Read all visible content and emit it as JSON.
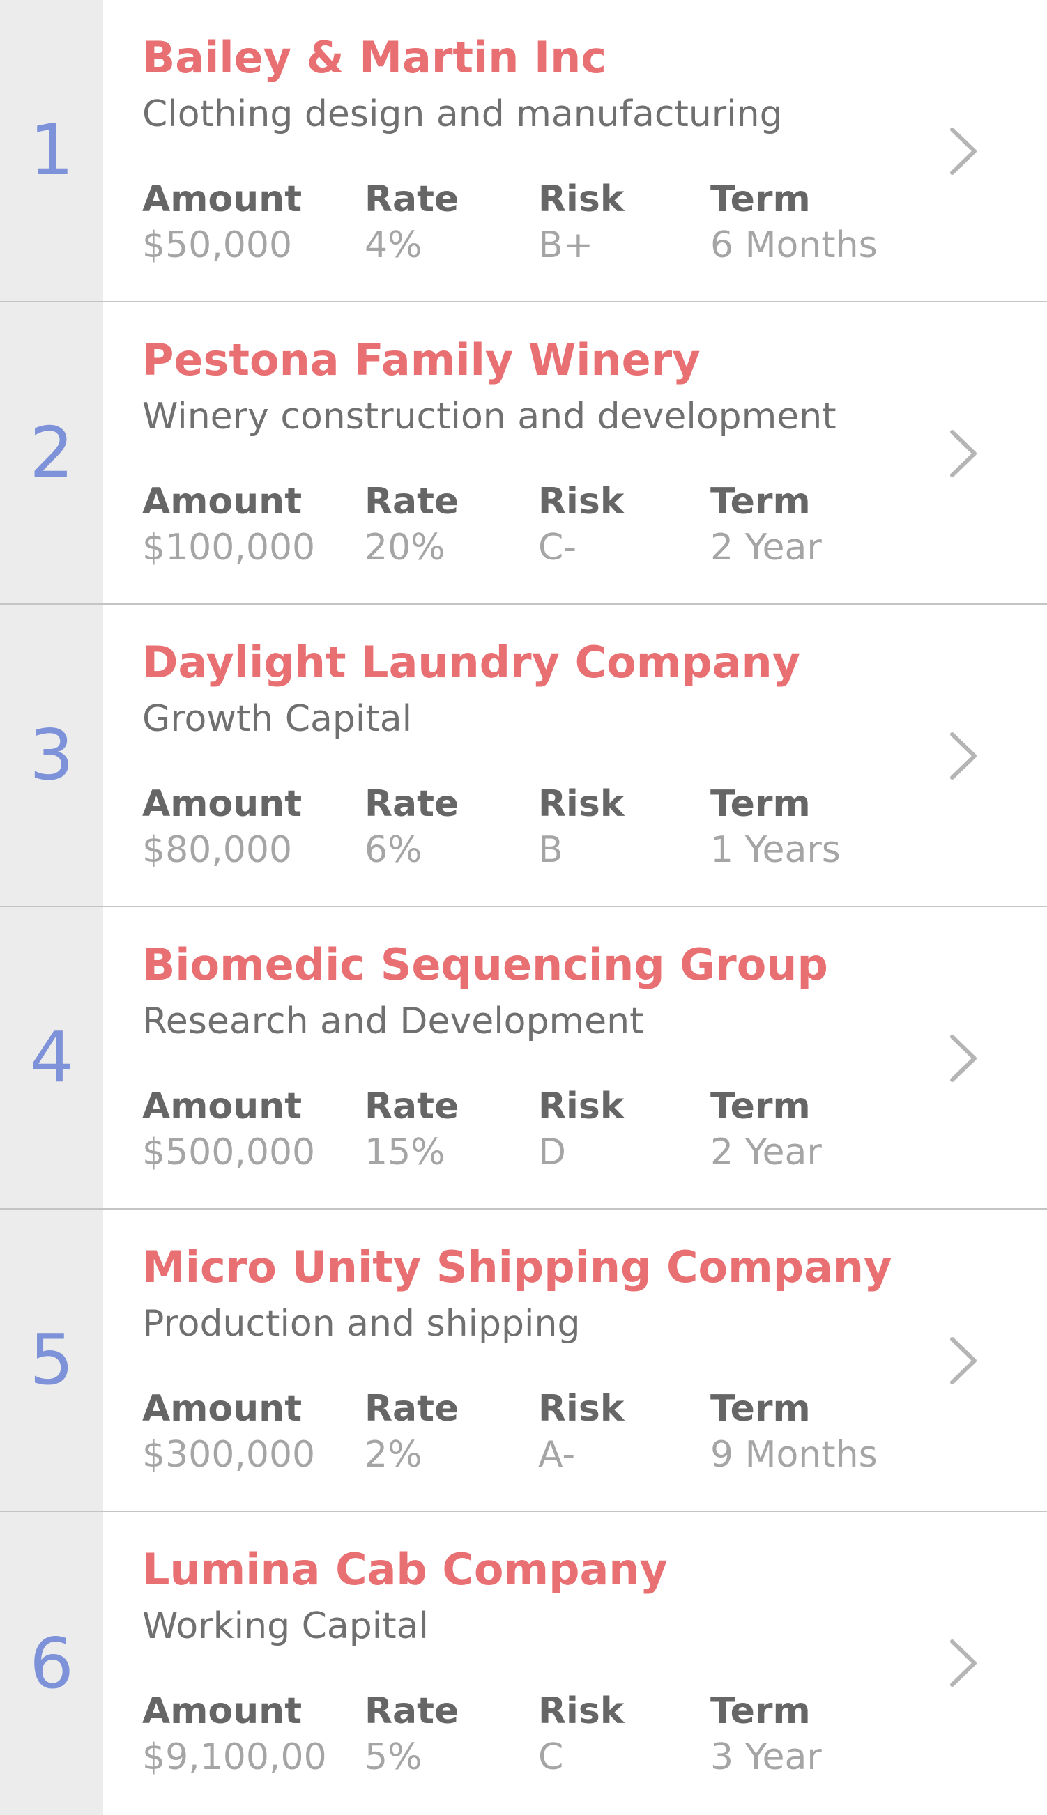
{
  "labels": {
    "amount": "Amount",
    "rate": "Rate",
    "risk": "Risk",
    "term": "Term"
  },
  "colors": {
    "rank": "#7d92d8",
    "company": "#e86f72",
    "rank_background": "#ececec",
    "divider": "#c4c4c4"
  },
  "icons": {
    "row_action": "chevron-right-icon"
  },
  "loans": [
    {
      "rank": "1",
      "company": "Bailey & Martin Inc",
      "purpose": "Clothing design and manufacturing",
      "amount": "$50,000",
      "rate": "4%",
      "risk": "B+",
      "term": "6 Months"
    },
    {
      "rank": "2",
      "company": "Pestona Family Winery",
      "purpose": "Winery construction and development",
      "amount": "$100,000",
      "rate": "20%",
      "risk": "C-",
      "term": "2 Year"
    },
    {
      "rank": "3",
      "company": "Daylight Laundry Company",
      "purpose": "Growth Capital",
      "amount": "$80,000",
      "rate": "6%",
      "risk": "B",
      "term": "1 Years"
    },
    {
      "rank": "4",
      "company": "Biomedic Sequencing Group",
      "purpose": "Research and Development",
      "amount": "$500,000",
      "rate": "15%",
      "risk": "D",
      "term": "2 Year"
    },
    {
      "rank": "5",
      "company": "Micro Unity Shipping Company",
      "purpose": "Production and shipping",
      "amount": "$300,000",
      "rate": "2%",
      "risk": "A-",
      "term": "9 Months"
    },
    {
      "rank": "6",
      "company": "Lumina Cab Company",
      "purpose": "Working Capital",
      "amount": "$9,100,00",
      "rate": "5%",
      "risk": "C",
      "term": "3 Year"
    }
  ]
}
